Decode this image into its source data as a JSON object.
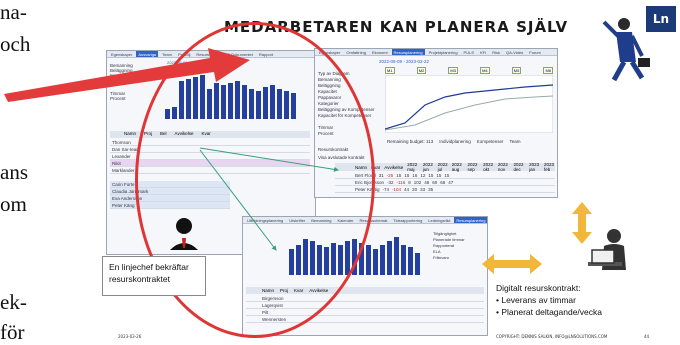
{
  "left_text": [
    "na-",
    "och",
    "ans",
    "om",
    "ek-",
    "för"
  ],
  "slide": {
    "title": "MEDARBETAREN KAN PLANERA SJÄLV",
    "logo_text": "Ln",
    "note": "En linjechef bekräftar resurskontraktet",
    "digital_title": "Digitalt resurskontrakt:",
    "digital_items": [
      "Leverans av timmar",
      "Planerat deltagande/vecka"
    ],
    "date": "2023-03-26",
    "copyright": "COPYRIGHT: DENNIS SALKIN, INFO@LNSOLUTIONS.COM",
    "page": "44"
  },
  "right_shot": {
    "tabs": [
      "Egenskaper",
      "Omfattning",
      "Ekonomi",
      "Resursplanering",
      "Projektplanering",
      "PULS",
      "KFI",
      "Risk",
      "QA-Vidéo",
      "Forum"
    ],
    "active_tab": "Resursplanering",
    "period": "2022-05-09 - 2023-02-22",
    "milestones": [
      "M1",
      "M2",
      "M3",
      "M4",
      "M5",
      "M6"
    ],
    "diagram_title": "Typ av Diagram",
    "diagram_options": [
      "Bemanning",
      "Beläggning",
      "Kapacitet",
      "Pappavaror",
      "Kategorier",
      "Beläggning av Kompetenser",
      "Kapacitet för Kompetenser"
    ],
    "radio_options": [
      "Timmar",
      "Procent"
    ],
    "remaining": "Remaining budget: 113",
    "legend": [
      "Individplanering",
      "Kompetenser",
      "Team"
    ],
    "contract_label": "Resurskontrakt",
    "contract_check": "Visa avslutade kontrakt",
    "table_headers": [
      "Namn",
      "Kvar",
      "Avvikelse",
      "2022 maj",
      "2022 jun",
      "2022 jul",
      "2022 aug",
      "2022 sep",
      "2022 okt",
      "2022 nov",
      "2022 dec",
      "2023 jan",
      "2023 feb"
    ],
    "rows": [
      {
        "name": "Bert Flood",
        "kvar": "31",
        "avv": "-25",
        "vals": [
          "15",
          "15",
          "16",
          "12",
          "15",
          "15",
          "15",
          "",
          "",
          ""
        ]
      },
      {
        "name": "Eric Bjornsson",
        "kvar": "-32",
        "avv": "-116",
        "vals": [
          "8",
          "102",
          "48",
          "60",
          "66",
          "47",
          "",
          "",
          "",
          ""
        ]
      },
      {
        "name": "Peter Kästig",
        "kvar": "-74",
        "avv": "-104",
        "vals": [
          "",
          "44",
          "",
          "20",
          "33",
          "35",
          "",
          "",
          "",
          ""
        ]
      }
    ]
  },
  "left_shot": {
    "tabs": [
      "Egenskaper",
      "Ansvariga",
      "Team",
      "Portfölj",
      "Resursformer",
      "Bl Dokumentet",
      "Rapport"
    ],
    "active_tab": "Ansvariga",
    "period": "2022-06-09 - 2023-02-22",
    "options": [
      "Bemanning",
      "Beläggning",
      "Kapacitet",
      "Pappavaror"
    ],
    "radio": [
      "Timmar",
      "Procent"
    ],
    "table_headers": [
      "Namn",
      "Proj",
      "Bel",
      "Avvikelse",
      "Kvar"
    ],
    "rows": [
      "Thomson",
      "Dan Sar-team",
      "Lexander",
      "Rikit",
      "Marklander"
    ],
    "people": [
      "Carin Forte",
      "Claudia Janemark",
      "Eva Andersson",
      "Peter Käng"
    ]
  },
  "bottom_shot": {
    "tabs": [
      "Utbildningsplanering",
      "Utskrifter",
      "Bemanning",
      "Kalender",
      "Resursschemat",
      "Tidsrapportering",
      "Ledningsråd",
      "Resursplanering",
      "Pappavaror",
      "Rapporter"
    ],
    "active_tab": "Resursplanering",
    "legend": [
      "Tillgänglighet",
      "Planerade timmar",
      "Rapporterat",
      "ELA",
      "Frånvaro"
    ],
    "table_headers": [
      "Namn",
      "Proj",
      "Kvar",
      "Avvikelse"
    ],
    "rows": [
      "Birgersson",
      "Lagerqvist",
      "Pilt",
      "Wennersten"
    ]
  },
  "colors": {
    "accent_red": "#e03535",
    "bar_blue": "#243f9e",
    "tab_blue": "#2f63c8",
    "arrow_gold": "#f0b73a"
  }
}
